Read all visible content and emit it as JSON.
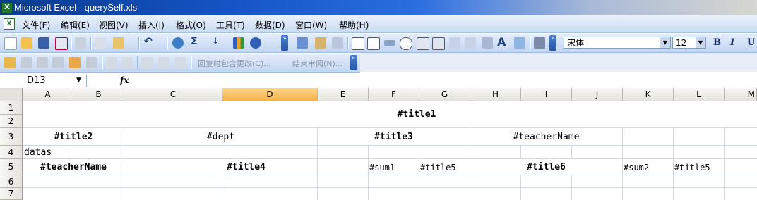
{
  "window": {
    "title": "Microsoft Excel - querySelf.xls",
    "app_icon_letter": "X"
  },
  "menu": [
    "文件(F)",
    "编辑(E)",
    "视图(V)",
    "插入(I)",
    "格式(O)",
    "工具(T)",
    "数据(D)",
    "窗口(W)",
    "帮助(H)"
  ],
  "toolbar": {
    "font_name": "宋体",
    "font_size": "12",
    "bold_label": "B",
    "italic_label": "I",
    "underline_label": "U",
    "sum_label": "Σ",
    "review_reply_label": "回复时包含更改(C)...",
    "review_end_label": "结束审阅(N)..."
  },
  "formula_bar": {
    "name_box": "D13",
    "fx_label": "fx",
    "value": ""
  },
  "columns": [
    "A",
    "B",
    "C",
    "D",
    "E",
    "F",
    "G",
    "H",
    "I",
    "J",
    "K",
    "L",
    "M"
  ],
  "selected_column": "D",
  "rows": [
    "1",
    "2",
    "3",
    "4",
    "5",
    "6",
    "7"
  ],
  "cells": {
    "title1": "#title1",
    "title2": "#title2",
    "dept": "#dept",
    "title3": "#title3",
    "teacherName_r3": "#teacherName",
    "datas": "datas",
    "teacherName_r5": "#teacherName",
    "title4": "#title4",
    "sum1": "#sum1",
    "title5_g": "#title5",
    "title6": "#title6",
    "sum2": "#sum2",
    "title5_l": "#title5"
  },
  "colors": {
    "selected_header": "#f4b24a",
    "title_bar": "#1554c4",
    "grid_line": "#d0d7e5"
  }
}
